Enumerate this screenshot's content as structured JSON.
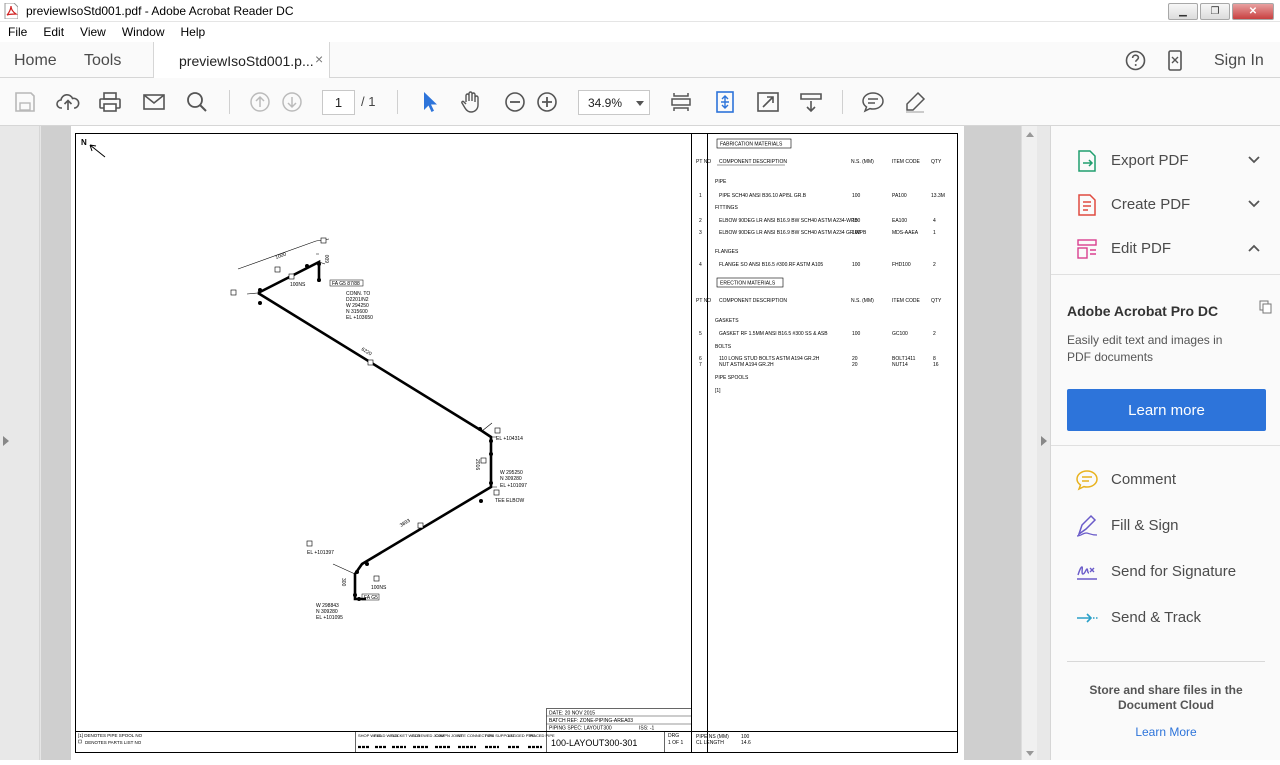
{
  "window": {
    "title": "previewIsoStd001.pdf - Adobe Acrobat Reader DC",
    "minimize": "▁",
    "restore": "❐",
    "close": "✕"
  },
  "menu": [
    "File",
    "Edit",
    "View",
    "Window",
    "Help"
  ],
  "nav": {
    "home": "Home",
    "tools": "Tools",
    "doc_tab": "previewIsoStd001.p...",
    "tab_close": "×",
    "sign_in": "Sign In"
  },
  "toolbar": {
    "page_current": "1",
    "page_total": "/ 1",
    "zoom": "34.9%"
  },
  "right_pane": {
    "export_pdf": "Export PDF",
    "create_pdf": "Create PDF",
    "edit_pdf": "Edit PDF",
    "promo_title": "Adobe Acrobat Pro DC",
    "promo_text": "Easily edit text and images in PDF documents",
    "learn_more_button": "Learn more",
    "comment": "Comment",
    "fill_sign": "Fill & Sign",
    "send_signature": "Send for Signature",
    "send_track": "Send & Track",
    "store_text": "Store and share files in the Document Cloud",
    "store_link": "Learn More"
  },
  "drawing": {
    "north": "N",
    "conn_label": "CONN. TO",
    "conn_ref": "D2201/N2",
    "conn_w": "W 294250",
    "conn_n": "N 315600",
    "conn_el": "EL +103650",
    "fa_label_1": "FA G5 87/88",
    "ns_label_1": "100NS",
    "dim_1000": "1000",
    "dim_600": "600",
    "dim_6220": "6220",
    "el_104314": "EL +104314",
    "dim_2016": "2016",
    "tee_w": "W 295250",
    "tee_n": "N 309280",
    "tee_el": "EL +101097",
    "tee_label": "TEE ELBOW",
    "dim_3893": "3893",
    "el_101397": "EL +101397",
    "bot_w": "W 298843",
    "bot_n": "N 309280",
    "bot_el": "EL +101095",
    "ns_label_2": "100NS",
    "fa_label_2": "FA G5",
    "dim_300": "300"
  },
  "bom": {
    "fab_title": "FABRICATION MATERIALS",
    "pt_no": "PT NO",
    "comp_desc": "COMPONENT DESCRIPTION",
    "ns_mm": "N.S. (MM)",
    "item_code": "ITEM CODE",
    "qty": "QTY",
    "pipe_head": "PIPE",
    "pipe_row": [
      "1",
      "PIPE SCH40 ANSI B36.10 API5L GR.B",
      "100",
      "PA100",
      "13.3M"
    ],
    "fittings_head": "FITTINGS",
    "fit_row_1": [
      "2",
      "ELBOW 90DEG LR ANSI B16.9 BW SCH40 ASTM A234-WPB",
      "100",
      "EA100",
      "4"
    ],
    "fit_row_2": [
      "3",
      "ELBOW 90DEG LR ANSI B16.9 BW SCH40 ASTM A234 GR.WPB",
      "100",
      "MDS-AAEA",
      "1"
    ],
    "flanges_head": "FLANGES",
    "fl_row": [
      "4",
      "FLANGE SO ANSI B16.5 #300.RF ASTM A105",
      "100",
      "FHD100",
      "2"
    ],
    "erec_title": "ERECTION MATERIALS",
    "gaskets_head": "GASKETS",
    "gk_row": [
      "5",
      "GASKET RF 1.5MM ANSI B16.5 #300 SS & ASB",
      "100",
      "GC100",
      "2"
    ],
    "bolts_head": "BOLTS",
    "bolt_row_1": [
      "6",
      "110 LONG STUD BOLTS ASTM A194 GR.2H",
      "20",
      "BOLT1411",
      "8"
    ],
    "bolt_row_2": [
      "7",
      "NUT ASTM A194 GR.2H",
      "20",
      "NUT14",
      "16"
    ],
    "spools_head": "PIPE SPOOLS",
    "spool_ref": "[1]"
  },
  "title_block": {
    "date": "DATE: 20 NOV 2015",
    "batch": "BATCH REF: ZONE-PIPING-AREA03",
    "spec": "PIPING SPEC: LAYOUT300",
    "iss": "ISS: -1",
    "drg": "DRG",
    "sheet": "1 OF 1",
    "drawing_no": "100-LAYOUT300-301",
    "pipe_ns": "PIPE NS   (MM)",
    "pipe_ns_val": "100",
    "cl_length": "CL LENGTH",
    "cl_length_val": "14.6",
    "legend_1": "[1] DENOTES PIPE SPOOL NO",
    "legend_2": "DENOTES PARTS LIST NO",
    "weld_labels": [
      "SHOP WELD",
      "FIELD WELD",
      "SOCKET WELD",
      "SCREWED JOINT",
      "COMPN JOINT",
      "SITE CONNECTION",
      "PIPE SUPPORT",
      "LAGGED PIPE",
      "TRACED PIPE"
    ]
  }
}
